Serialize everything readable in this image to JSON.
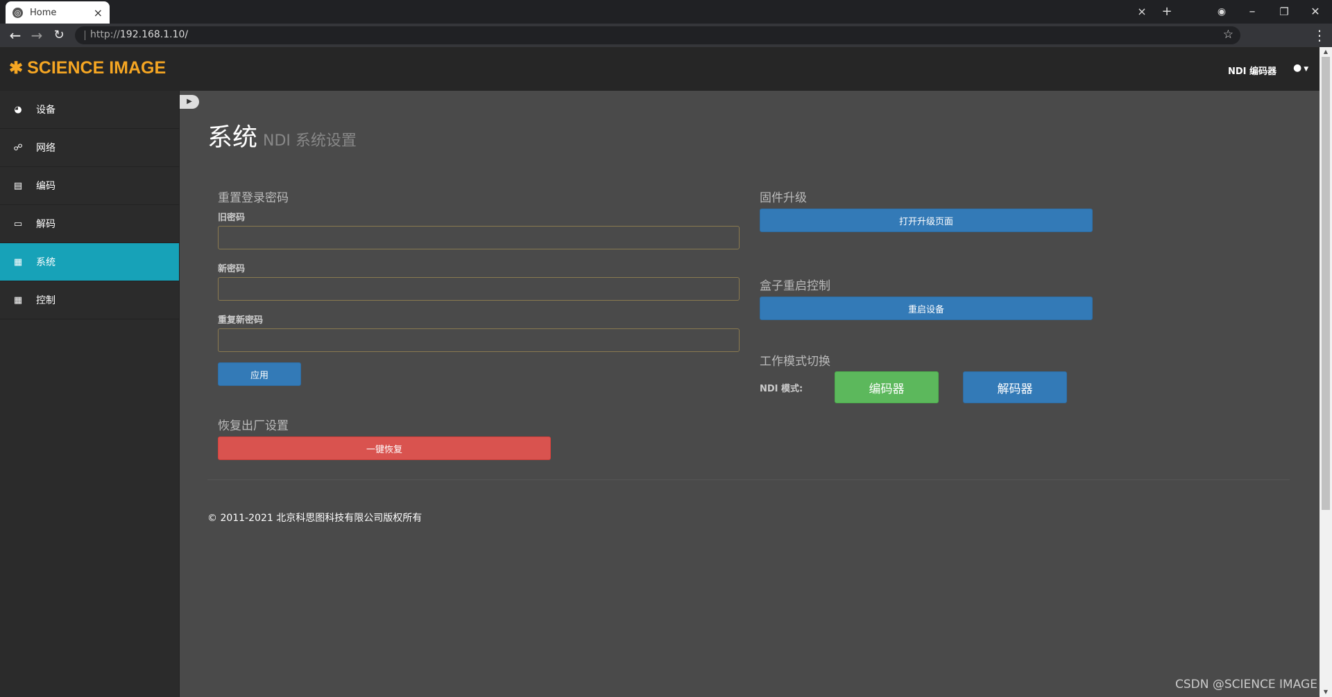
{
  "browser": {
    "tab_title": "Home",
    "tab_close": "×",
    "new_tab": "+",
    "url_protocol": "http://",
    "url_host": "192.168.1.10/",
    "window_controls": [
      "×",
      "+",
      "▾",
      "—",
      "❐",
      "✕"
    ]
  },
  "header": {
    "logo_text": "SCIENCE IMAGE",
    "logo_icon": "gear-icon",
    "device_link": "NDI 编码器",
    "user_icon": "user-icon",
    "brand_color": "#f5a623"
  },
  "sidebar": {
    "items": [
      {
        "label": "设备",
        "icon": "dashboard-icon",
        "glyph": "◕"
      },
      {
        "label": "网络",
        "icon": "sitemap-icon",
        "glyph": "☍"
      },
      {
        "label": "编码",
        "icon": "bar-chart-icon",
        "glyph": "▤"
      },
      {
        "label": "解码",
        "icon": "monitor-icon",
        "glyph": "▭"
      },
      {
        "label": "系统",
        "icon": "server-icon",
        "glyph": "▦",
        "active": true
      },
      {
        "label": "控制",
        "icon": "table-icon",
        "glyph": "▦"
      }
    ],
    "active_color": "#17a2b8"
  },
  "page": {
    "title": "系统",
    "subtitle": "NDI 系统设置"
  },
  "password": {
    "section_title": "重置登录密码",
    "old_label": "旧密码",
    "new_label": "新密码",
    "repeat_label": "重复新密码",
    "apply_button": "应用"
  },
  "factory": {
    "section_title": "恢复出厂设置",
    "reset_button": "一键恢复"
  },
  "firmware": {
    "section_title": "固件升级",
    "open_button": "打开升级页面"
  },
  "reboot": {
    "section_title": "盒子重启控制",
    "reboot_button": "重启设备"
  },
  "mode": {
    "section_title": "工作模式切换",
    "label": "NDI 模式:",
    "encoder_button": "编码器",
    "decoder_button": "解码器"
  },
  "footer": {
    "copyright": "© 2011-2021 北京科思图科技有限公司版权所有"
  },
  "watermark": "CSDN @SCIENCE IMAGE"
}
